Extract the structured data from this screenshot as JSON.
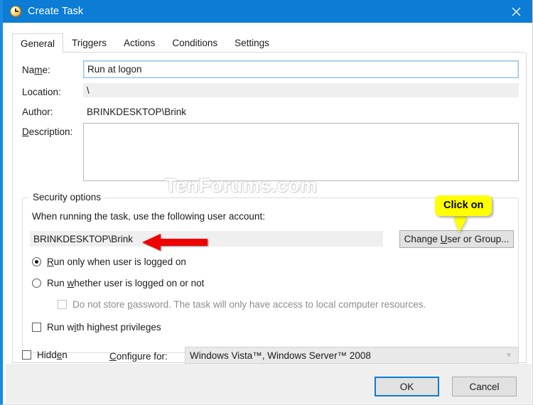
{
  "window": {
    "title": "Create Task",
    "icon": "clock-icon",
    "close_label": "✕",
    "titlebar_color": "#0c7cd5"
  },
  "tabs": [
    {
      "label": "General",
      "active": true
    },
    {
      "label": "Triggers",
      "active": false
    },
    {
      "label": "Actions",
      "active": false
    },
    {
      "label": "Conditions",
      "active": false
    },
    {
      "label": "Settings",
      "active": false
    }
  ],
  "form": {
    "name_label_pre": "Na",
    "name_label_accel": "m",
    "name_label_post": "e:",
    "name_value": "Run at logon",
    "location_label": "Location:",
    "location_value": "\\",
    "author_label": "Author:",
    "author_value": "BRINKDESKTOP\\Brink",
    "description_label_accel": "D",
    "description_label_post": "escription:",
    "description_value": ""
  },
  "security": {
    "group_title": "Security options",
    "account_prompt": "When running the task, use the following user account:",
    "account_value": "BRINKDESKTOP\\Brink",
    "change_user_pre": "Change ",
    "change_user_accel": "U",
    "change_user_post": "ser or Group...",
    "radio_logged_on_pre": "R",
    "radio_logged_on_post": "un only when user is logged on",
    "radio_logged_on_checked": true,
    "radio_whether_pre": "Run ",
    "radio_whether_accel": "w",
    "radio_whether_post": "hether user is logged on or not",
    "radio_whether_checked": false,
    "check_password_pre": "Do not store ",
    "check_password_accel": "p",
    "check_password_post": "assword.  The task will only have access to local computer resources.",
    "check_password_checked": false,
    "check_password_disabled": true,
    "check_privileges_pre": "Run w",
    "check_privileges_accel": "i",
    "check_privileges_post": "th highest privileges",
    "check_privileges_checked": false
  },
  "bottom": {
    "hidden_pre": "Hidd",
    "hidden_accel": "e",
    "hidden_post": "n",
    "hidden_checked": false,
    "configure_accel": "C",
    "configure_post": "onfigure for:",
    "configure_value": "Windows Vista™, Windows Server™ 2008",
    "caret_icon": "chevron-down-icon"
  },
  "footer": {
    "ok_label": "OK",
    "cancel_label": "Cancel"
  },
  "annotations": {
    "callout_text": "Click on",
    "callout_color": "#ffff00",
    "arrow_icon": "red-left-arrow-icon",
    "arrow_color": "#ee0000"
  },
  "watermark": {
    "text": "TenForums.com"
  }
}
